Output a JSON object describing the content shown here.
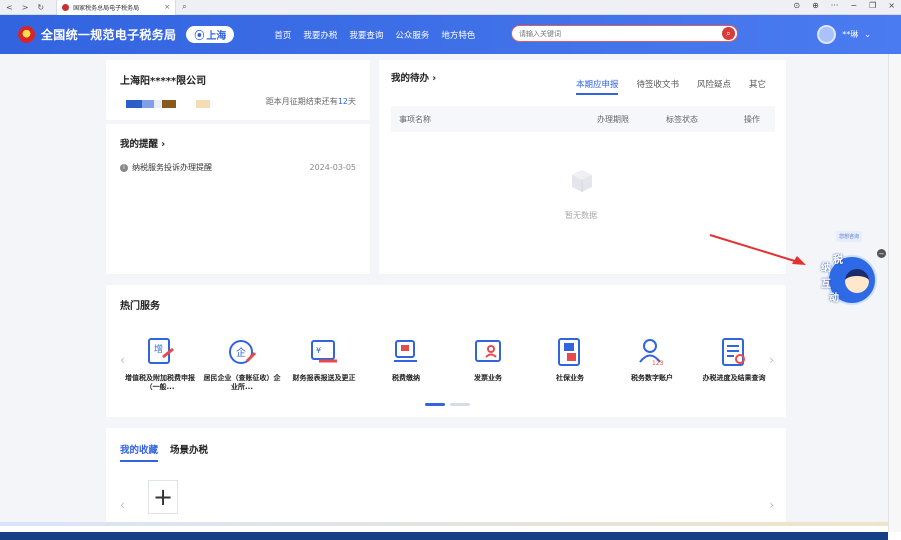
{
  "browser": {
    "tab_title": "国家税务总局电子税务局",
    "tab_close": "×",
    "nav_back": "<",
    "nav_forward": ">",
    "nav_refresh": "↻"
  },
  "header": {
    "site_title": "全国统一规范电子税务局",
    "region": "上海",
    "nav": [
      "首页",
      "我要办税",
      "我要查询",
      "公众服务",
      "地方特色"
    ],
    "search_placeholder": "请输入关键词",
    "user_name": "**琳"
  },
  "company": {
    "name": "上海阳*****限公司",
    "deadline_prefix": "距本月征期结束还有",
    "deadline_days": "12",
    "deadline_suffix": "天"
  },
  "reminder": {
    "title": "我的提醒 ›",
    "item": "纳税服务投诉办理提醒",
    "date": "2024-03-05"
  },
  "todo": {
    "title": "我的待办 ›",
    "tabs": [
      "本期应申报",
      "待签收文书",
      "风险疑点",
      "其它"
    ],
    "columns": [
      "事项名称",
      "办理期限",
      "标签状态",
      "操作"
    ],
    "empty_text": "暂无数据"
  },
  "hot_services": {
    "title": "热门服务",
    "items": [
      "增值税及附加税费申报（一般...",
      "居民企业（查账征收）企业所...",
      "财务报表报送及更正",
      "税费缴纳",
      "发票业务",
      "社保业务",
      "税务数字账户",
      "办税进度及结果查询"
    ]
  },
  "favorites": {
    "tabs": [
      "我的收藏",
      "场景办税"
    ],
    "add": "+"
  },
  "assistant": {
    "tip": "您想咨询",
    "chars": [
      "纳",
      "税",
      "互",
      "动"
    ]
  },
  "colors": {
    "brand": "#3264e0",
    "accent_red": "#d93a3a"
  }
}
